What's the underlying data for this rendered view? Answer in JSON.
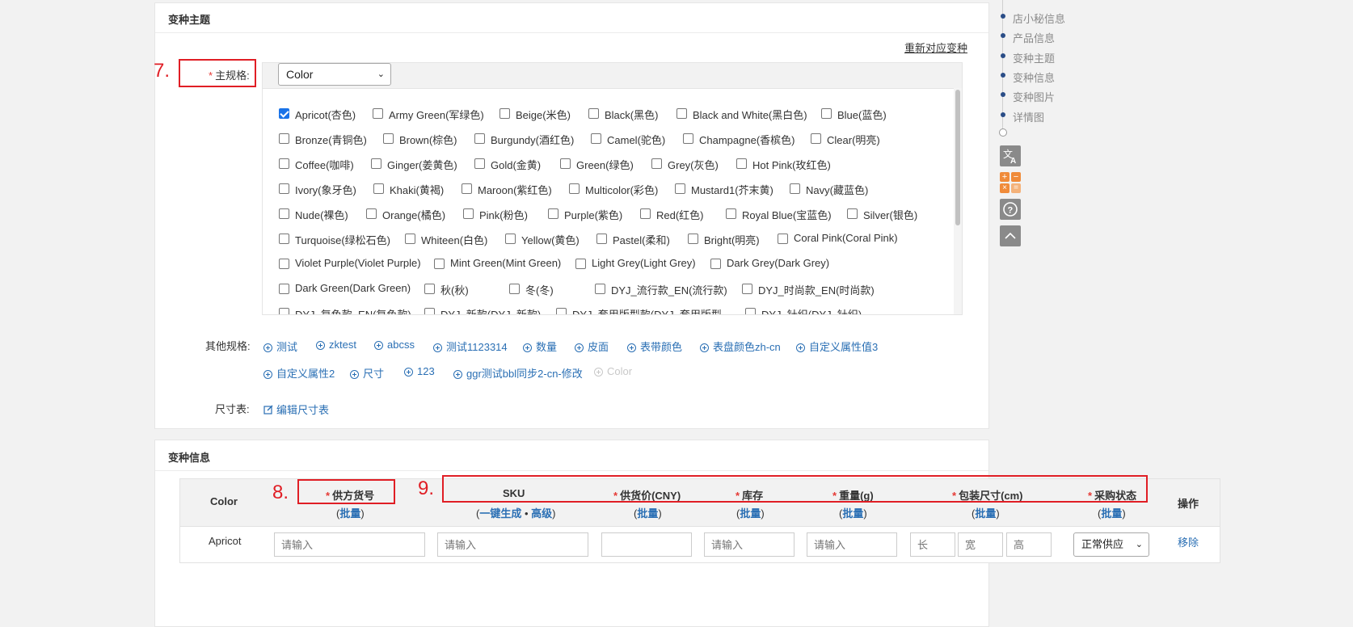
{
  "variant_theme_panel": {
    "title": "变种主题",
    "rematch_link": "重新对应变种",
    "main_spec_label": "主规格:",
    "main_spec_select": "Color",
    "colors": [
      {
        "label": "Apricot(杏色)",
        "checked": true
      },
      {
        "label": "Army Green(军绿色)",
        "checked": false
      },
      {
        "label": "Beige(米色)",
        "checked": false
      },
      {
        "label": "Black(黑色)",
        "checked": false
      },
      {
        "label": "Black and White(黑白色)",
        "checked": false
      },
      {
        "label": "Blue(蓝色)",
        "checked": false
      },
      {
        "label": "Bronze(青铜色)",
        "checked": false
      },
      {
        "label": "Brown(棕色)",
        "checked": false
      },
      {
        "label": "Burgundy(酒红色)",
        "checked": false
      },
      {
        "label": "Camel(驼色)",
        "checked": false
      },
      {
        "label": "Champagne(香槟色)",
        "checked": false
      },
      {
        "label": "Clear(明亮)",
        "checked": false
      },
      {
        "label": "Coffee(咖啡)",
        "checked": false
      },
      {
        "label": "Ginger(姜黄色)",
        "checked": false
      },
      {
        "label": "Gold(金黄)",
        "checked": false
      },
      {
        "label": "Green(绿色)",
        "checked": false
      },
      {
        "label": "Grey(灰色)",
        "checked": false
      },
      {
        "label": "Hot Pink(玫红色)",
        "checked": false
      },
      {
        "label": "Ivory(象牙色)",
        "checked": false
      },
      {
        "label": "Khaki(黄褐)",
        "checked": false
      },
      {
        "label": "Maroon(紫红色)",
        "checked": false
      },
      {
        "label": "Multicolor(彩色)",
        "checked": false
      },
      {
        "label": "Mustard1(芥末黄)",
        "checked": false
      },
      {
        "label": "Navy(藏蓝色)",
        "checked": false
      },
      {
        "label": "Nude(裸色)",
        "checked": false
      },
      {
        "label": "Orange(橘色)",
        "checked": false
      },
      {
        "label": "Pink(粉色)",
        "checked": false
      },
      {
        "label": "Purple(紫色)",
        "checked": false
      },
      {
        "label": "Red(红色)",
        "checked": false
      },
      {
        "label": "Royal Blue(宝蓝色)",
        "checked": false
      },
      {
        "label": "Silver(银色)",
        "checked": false
      },
      {
        "label": "Turquoise(绿松石色)",
        "checked": false
      },
      {
        "label": "Whiteen(白色)",
        "checked": false
      },
      {
        "label": "Yellow(黄色)",
        "checked": false
      },
      {
        "label": "Pastel(柔和)",
        "checked": false
      },
      {
        "label": "Bright(明亮)",
        "checked": false
      },
      {
        "label": "Coral Pink(Coral Pink)",
        "checked": false
      },
      {
        "label": "Violet Purple(Violet Purple)",
        "checked": false
      },
      {
        "label": "Mint Green(Mint Green)",
        "checked": false
      },
      {
        "label": "Light Grey(Light Grey)",
        "checked": false
      },
      {
        "label": "Dark Grey(Dark Grey)",
        "checked": false
      },
      {
        "label": "Dark Green(Dark Green)",
        "checked": false
      },
      {
        "label": "秋(秋)",
        "checked": false
      },
      {
        "label": "冬(冬)",
        "checked": false
      },
      {
        "label": "DYJ_流行款_EN(流行款)",
        "checked": false
      },
      {
        "label": "DYJ_时尚款_EN(时尚款)",
        "checked": false
      },
      {
        "label": "DYJ_复色款_EN(复色款)",
        "checked": false
      },
      {
        "label": "DYJ_新款(DYJ_新款)",
        "checked": false
      },
      {
        "label": "DYJ_套用版型款(DYJ_套用版型",
        "checked": false
      },
      {
        "label": "DYJ_针织(DYJ_针织)",
        "checked": false
      }
    ],
    "other_spec_label": "其他规格:",
    "other_specs": [
      {
        "label": "测试",
        "disabled": false
      },
      {
        "label": "zktest",
        "disabled": false
      },
      {
        "label": "abcss",
        "disabled": false
      },
      {
        "label": "测试1123314",
        "disabled": false
      },
      {
        "label": "数量",
        "disabled": false
      },
      {
        "label": "皮面",
        "disabled": false
      },
      {
        "label": "表带颜色",
        "disabled": false
      },
      {
        "label": "表盘颜色zh-cn",
        "disabled": false
      },
      {
        "label": "自定义属性值3",
        "disabled": false
      },
      {
        "label": "自定义属性2",
        "disabled": false
      },
      {
        "label": "尺寸",
        "disabled": false
      },
      {
        "label": "123",
        "disabled": false
      },
      {
        "label": "ggr测试bbl同步2-cn-修改",
        "disabled": false
      },
      {
        "label": "Color",
        "disabled": true
      }
    ],
    "size_chart_label": "尺寸表:",
    "size_chart_edit": "编辑尺寸表"
  },
  "variant_info_panel": {
    "title": "变种信息",
    "headers": {
      "color": "Color",
      "supplier_no": "供方货号",
      "sku": "SKU",
      "price": "供货价(CNY)",
      "stock": "库存",
      "weight": "重量(g)",
      "package": "包装尺寸(cm)",
      "purchase": "采购状态",
      "ops": "操作"
    },
    "bulk": "批量",
    "one_click": "一键生成",
    "advanced": "高级",
    "row": {
      "color": "Apricot",
      "placeholder": "请输入",
      "len": "长",
      "wid": "宽",
      "hei": "高",
      "status": "正常供应",
      "remove": "移除"
    }
  },
  "side_nav": {
    "items": [
      "店小秘信息",
      "产品信息",
      "变种主题",
      "变种信息",
      "变种图片",
      "详情图"
    ]
  },
  "annotations": {
    "n7": "7.",
    "n8": "8.",
    "n9": "9."
  },
  "colors": {
    "accent": "#2a6fb4",
    "annotation": "#e01e25",
    "checkbox": "#1a73e8"
  }
}
